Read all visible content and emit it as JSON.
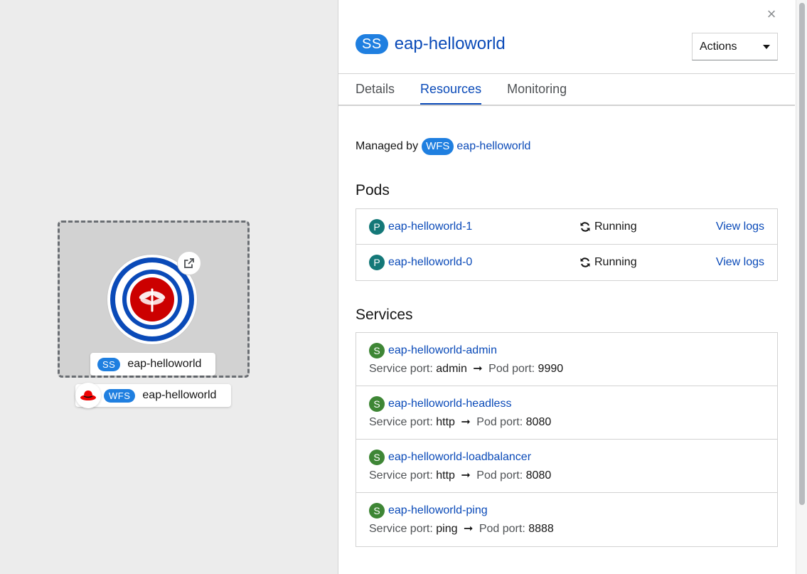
{
  "topology": {
    "node_label": "eap-helloworld",
    "node_badge": "SS",
    "group_label": "eap-helloworld",
    "group_badge": "WFS"
  },
  "panel": {
    "close_label": "×",
    "badge": "SS",
    "title": "eap-helloworld",
    "actions_label": "Actions",
    "tabs": [
      {
        "label": "Details",
        "active": false
      },
      {
        "label": "Resources",
        "active": true
      },
      {
        "label": "Monitoring",
        "active": false
      }
    ],
    "managed_by": {
      "prefix": "Managed by",
      "badge": "WFS",
      "name": "eap-helloworld"
    },
    "pods_title": "Pods",
    "pods": [
      {
        "badge": "P",
        "name": "eap-helloworld-1",
        "status": "Running",
        "action": "View logs"
      },
      {
        "badge": "P",
        "name": "eap-helloworld-0",
        "status": "Running",
        "action": "View logs"
      }
    ],
    "services_title": "Services",
    "services": [
      {
        "badge": "S",
        "name": "eap-helloworld-admin",
        "service_port_label": "Service port:",
        "service_port": "admin",
        "pod_port_label": "Pod port:",
        "pod_port": "9990"
      },
      {
        "badge": "S",
        "name": "eap-helloworld-headless",
        "service_port_label": "Service port:",
        "service_port": "http",
        "pod_port_label": "Pod port:",
        "pod_port": "8080"
      },
      {
        "badge": "S",
        "name": "eap-helloworld-loadbalancer",
        "service_port_label": "Service port:",
        "service_port": "http",
        "pod_port_label": "Pod port:",
        "pod_port": "8080"
      },
      {
        "badge": "S",
        "name": "eap-helloworld-ping",
        "service_port_label": "Service port:",
        "service_port": "ping",
        "pod_port_label": "Pod port:",
        "pod_port": "8888"
      }
    ]
  },
  "colors": {
    "link": "#0a4ab8",
    "badge_blue": "#1f7fe0",
    "pod_teal": "#147878",
    "service_green": "#3e8635",
    "node_red": "#cc0000"
  }
}
